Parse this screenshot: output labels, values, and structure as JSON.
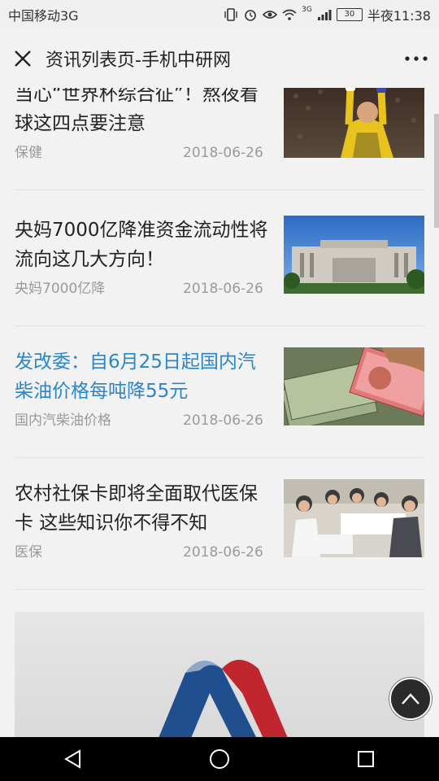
{
  "status_bar": {
    "carrier": "中国移动3G",
    "network": "3G",
    "battery": "30",
    "time": "半夜11:38"
  },
  "header": {
    "title": "资讯列表页-手机中研网",
    "close_icon": "close-icon",
    "more_icon": "more-dots-icon"
  },
  "news": [
    {
      "title": "当心“世界杯综合征”！熬夜看球这四点要注意",
      "tag": "保健",
      "date": "2018-06-26",
      "highlight": false
    },
    {
      "title": "央妈7000亿降准资金流动性将流向这几大方向！",
      "tag": "央妈7000亿降准",
      "date": "2018-06-26",
      "highlight": false
    },
    {
      "title": "发改委：自6月25日起国内汽柴油价格每吨降55元",
      "tag": "国内汽柴油价格",
      "date": "2018-06-26",
      "highlight": true
    },
    {
      "title": "农村社保卡即将全面取代医保卡 这些知识你不得不知",
      "tag": "医保",
      "date": "2018-06-26",
      "highlight": false
    }
  ],
  "colors": {
    "highlight": "#2a86c9",
    "meta": "#9a9a9a",
    "background": "#f2f2f2"
  },
  "icons": {
    "back_to_top": "chevron-up-icon",
    "nav_back": "triangle-back-icon",
    "nav_home": "circle-home-icon",
    "nav_recent": "square-recent-icon"
  }
}
